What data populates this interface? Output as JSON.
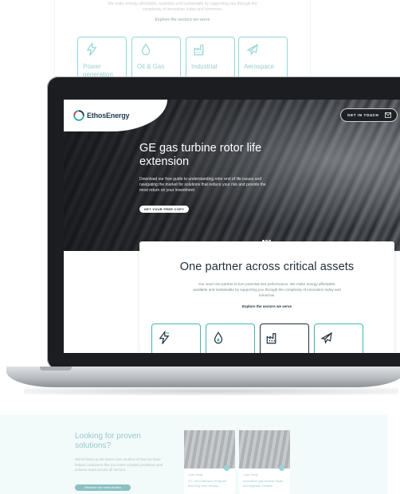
{
  "background_page": {
    "intro_text": "We make energy affordable, available and sustainable by supporting you through the complexity of innovation today and tomorrow.",
    "explore_link": "Explore the sectors we serve",
    "sectors": [
      {
        "label": "Power generation",
        "icon": "lightning-icon"
      },
      {
        "label": "Oil & Gas",
        "icon": "flame-icon"
      },
      {
        "label": "Industrial",
        "icon": "factory-icon"
      },
      {
        "label": "Aerospace",
        "icon": "airplane-icon"
      }
    ],
    "bottom": {
      "title": "Looking for proven solutions?",
      "body": "We've lined up the latest case studies of how we have helped customers like you solve complex problems and achieve more across all sectors.",
      "cta": "Discover our case studies",
      "cases": [
        {
          "tag": "Case Study",
          "text": "GT Life Extension Program and long term service"
        },
        {
          "tag": "Case Study",
          "text": "Innovative gas turbine repair and upgrade solution"
        }
      ]
    }
  },
  "screen": {
    "logo": {
      "name": "EthosEnergy",
      "brand_color": "#1d3b50",
      "accent": "#2aa6a9"
    },
    "get_in_touch": "GET IN TOUCH",
    "hero": {
      "title": "GE gas turbine rotor life extension",
      "body": "Download our free guide to understanding rotor end of life issues and navigating the market for solutions that reduce your risk and provide the most return on your investment",
      "cta": "GET YOUR FREE COPY",
      "slides": 3,
      "active_slide": 1
    },
    "partner": {
      "title": "One partner across critical assets",
      "body": "You need one partner to turn potential into performance. We make energy affordable, available and sustainable by supporting you through the complexity of innovation today and tomorrow.",
      "link": "Explore the sectors we serve",
      "tiles": [
        "lightning-icon",
        "flame-icon",
        "factory-icon",
        "airplane-icon"
      ]
    }
  },
  "colors": {
    "teal": "#3fb4b7",
    "dark": "#1f2124"
  }
}
